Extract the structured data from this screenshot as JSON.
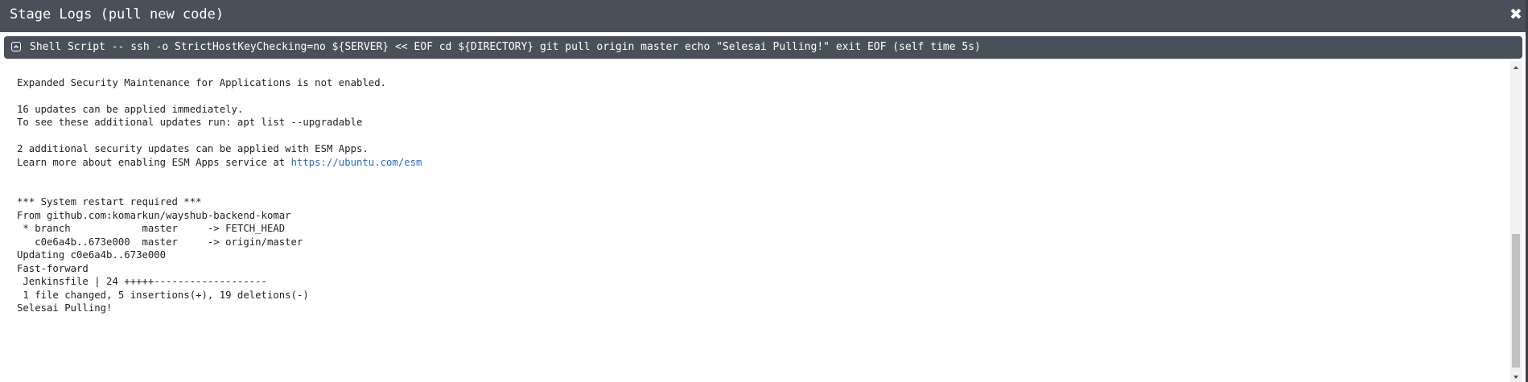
{
  "dialog": {
    "title": "Stage Logs (pull new code)",
    "close_glyph": "✖"
  },
  "step": {
    "icon": "collapse-icon",
    "title": "Shell Script -- ssh -o StrictHostKeyChecking=no ${SERVER} << EOF cd ${DIRECTORY} git pull origin master echo \"Selesai Pulling!\" exit EOF (self time 5s)"
  },
  "log": {
    "line_1": "Expanded Security Maintenance for Applications is not enabled.",
    "line_2": "16 updates can be applied immediately.",
    "line_3": "To see these additional updates run: apt list --upgradable",
    "line_4": "2 additional security updates can be applied with ESM Apps.",
    "line_5_prefix": "Learn more about enabling ESM Apps service at ",
    "line_5_link": "https://ubuntu.com/esm",
    "line_6": "*** System restart required ***",
    "line_7": "From github.com:komarkun/wayshub-backend-komar",
    "line_8": " * branch            master     -> FETCH_HEAD",
    "line_9": "   c0e6a4b..673e000  master     -> origin/master",
    "line_10": "Updating c0e6a4b..673e000",
    "line_11": "Fast-forward",
    "line_12": " Jenkinsfile | 24 +++++-------------------",
    "line_13": " 1 file changed, 5 insertions(+), 19 deletions(-)",
    "line_14": "Selesai Pulling!"
  },
  "colors": {
    "header_bg": "#4a5059",
    "link": "#2a6ad1",
    "text": "#222222"
  }
}
